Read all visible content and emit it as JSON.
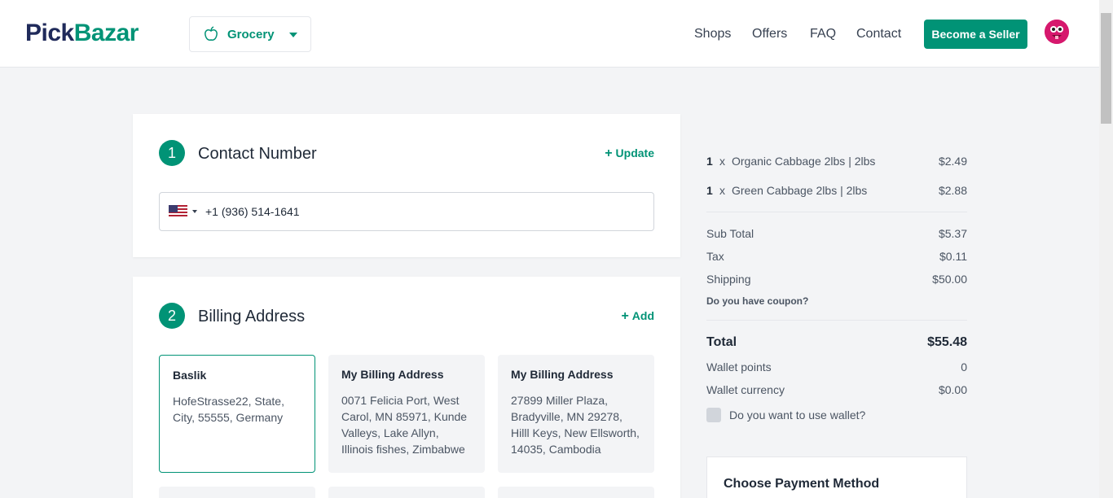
{
  "header": {
    "logo_part1": "Pick",
    "logo_part2": "Bazar",
    "shop_type": "Grocery",
    "nav": [
      "Shops",
      "Offers",
      "FAQ",
      "Contact"
    ],
    "seller_button": "Become a Seller",
    "brand_color": "#019376"
  },
  "contact": {
    "step": "1",
    "title": "Contact Number",
    "action": "Update",
    "phone": "+1 (936) 514-1641",
    "country_flag": "us-flag-icon"
  },
  "billing": {
    "step": "2",
    "title": "Billing Address",
    "action": "Add",
    "addresses": [
      {
        "title": "Baslik",
        "address": "HofeStrasse22, State, City, 55555, Germany",
        "selected": true
      },
      {
        "title": "My Billing Address",
        "address": "0071 Felicia Port, West Carol, MN 85971, Kunde Valleys, Lake Allyn, Illinois fishes, Zimbabwe",
        "selected": false
      },
      {
        "title": "My Billing Address",
        "address": "27899 Miller Plaza, Bradyville, MN 29278, Hilll Keys, New Ellsworth, 14035, Cambodia",
        "selected": false
      }
    ]
  },
  "summary": {
    "items": [
      {
        "qty": "1",
        "x": "x",
        "name": "Organic Cabbage 2lbs | 2lbs",
        "price": "$2.49"
      },
      {
        "qty": "1",
        "x": "x",
        "name": "Green Cabbage 2lbs | 2lbs",
        "price": "$2.88"
      }
    ],
    "subtotal_label": "Sub Total",
    "subtotal": "$5.37",
    "tax_label": "Tax",
    "tax": "$0.11",
    "shipping_label": "Shipping",
    "shipping": "$50.00",
    "coupon": "Do you have coupon?",
    "total_label": "Total",
    "total": "$55.48",
    "wallet_points_label": "Wallet points",
    "wallet_points": "0",
    "wallet_currency_label": "Wallet currency",
    "wallet_currency": "$0.00",
    "wallet_check": "Do you want to use wallet?",
    "payment_title": "Choose Payment Method"
  }
}
